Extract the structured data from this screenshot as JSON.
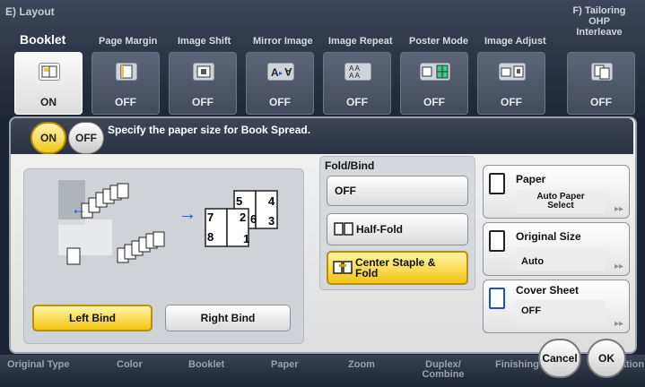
{
  "sections": {
    "left_title": "E)  Layout",
    "right_title": "F)  Tailoring\nOHP\nInterleave"
  },
  "tabs": [
    {
      "label": "Booklet",
      "state": "ON"
    },
    {
      "label": "Page Margin",
      "state": "OFF"
    },
    {
      "label": "Image Shift",
      "state": "OFF"
    },
    {
      "label": "Mirror Image",
      "state": "OFF"
    },
    {
      "label": "Image Repeat",
      "state": "OFF"
    },
    {
      "label": "Poster Mode",
      "state": "OFF"
    },
    {
      "label": "Image Adjust",
      "state": "OFF"
    },
    {
      "label": "",
      "state": "OFF"
    }
  ],
  "toggle": {
    "on": "ON",
    "off": "OFF",
    "selected": "ON"
  },
  "instruction": "Specify the paper size for Book Spread.",
  "diagram": {
    "spread_pages": [
      "5",
      "4",
      "6",
      "3",
      "7",
      "2",
      "8",
      "1"
    ]
  },
  "bind": {
    "left": "Left Bind",
    "right": "Right Bind",
    "selected": "Left Bind"
  },
  "fold_bind": {
    "title": "Fold/Bind",
    "options": [
      "OFF",
      "Half-Fold",
      "Center Staple & Fold"
    ],
    "selected": "Center Staple & Fold"
  },
  "right_panel": {
    "paper": {
      "title": "Paper",
      "value": "Auto Paper Select"
    },
    "original_size": {
      "title": "Original Size",
      "value": "Auto"
    },
    "cover_sheet": {
      "title": "Cover Sheet",
      "value": "OFF"
    }
  },
  "bottom_nav": [
    "Original Type",
    "Color",
    "Booklet",
    "Paper",
    "Zoom",
    "Duplex/\nCombine",
    "Finishing",
    "Application"
  ],
  "actions": {
    "cancel": "Cancel",
    "ok": "OK"
  },
  "colors": {
    "selected": "#f2c514",
    "arrow": "#1a4fd6",
    "header": "#2b3241"
  }
}
